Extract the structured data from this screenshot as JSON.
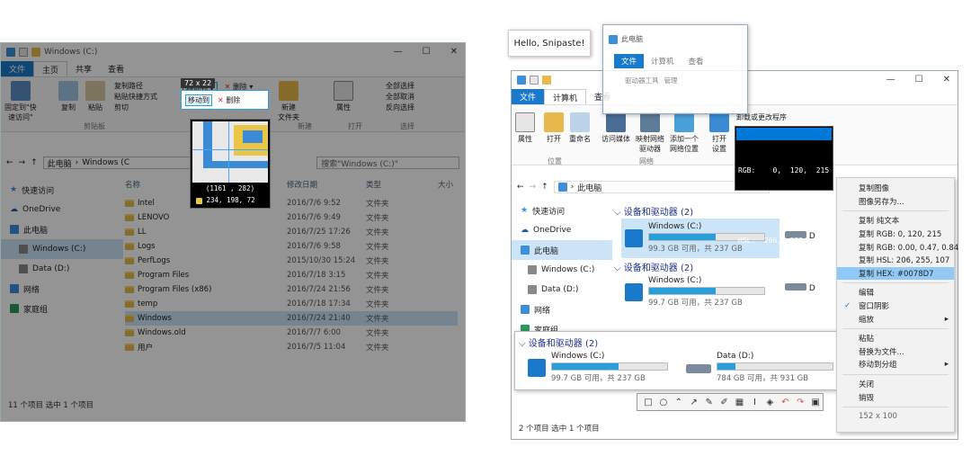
{
  "left": {
    "title": "Windows (C:)",
    "tabs": [
      "文件",
      "主页",
      "共享",
      "查看"
    ],
    "ribbon": {
      "pin": "固定到\"快\n速访问\"",
      "copy": "复制",
      "paste": "粘贴",
      "copy_path": "复制路径",
      "paste_shortcut": "粘贴快捷方式",
      "cut": "剪切",
      "move_to": "移动到",
      "delete": "删除",
      "new_folder": "新建\n文件夹",
      "properties": "属性",
      "select_all": "全部选择",
      "select_none": "全部取消",
      "invert": "反向选择",
      "group_clipboard": "剪贴板",
      "group_new": "新建",
      "group_open": "打开",
      "group_select": "选择"
    },
    "address": [
      "此电脑",
      "Windows (C"
    ],
    "search_placeholder": "搜索\"Windows (C:)\"",
    "nav": [
      "快速访问",
      "OneDrive",
      "此电脑",
      "Windows (C:)",
      "Data (D:)",
      "网络",
      "家庭组"
    ],
    "headers": [
      "名称",
      "修改日期",
      "类型",
      "大小"
    ],
    "files": [
      {
        "name": "Intel",
        "date": "2016/7/6 9:52",
        "type": "文件夹"
      },
      {
        "name": "LENOVO",
        "date": "2016/7/6 9:49",
        "type": "文件夹"
      },
      {
        "name": "LL",
        "date": "2016/7/25 17:26",
        "type": "文件夹"
      },
      {
        "name": "Logs",
        "date": "2016/7/6 9:58",
        "type": "文件夹"
      },
      {
        "name": "PerfLogs",
        "date": "2015/10/30 15:24",
        "type": "文件夹"
      },
      {
        "name": "Program Files",
        "date": "2016/7/18 3:15",
        "type": "文件夹"
      },
      {
        "name": "Program Files (x86)",
        "date": "2016/7/24 21:56",
        "type": "文件夹"
      },
      {
        "name": "temp",
        "date": "2016/7/18 17:34",
        "type": "文件夹"
      },
      {
        "name": "Windows",
        "date": "2016/7/24 21:40",
        "type": "文件夹"
      },
      {
        "name": "Windows.old",
        "date": "2016/7/7 6:00",
        "type": "文件夹"
      },
      {
        "name": "用户",
        "date": "2016/7/5 11:04",
        "type": "文件夹"
      }
    ],
    "status": "11 个项目    选中 1 个项目",
    "size_label": "72 x 22",
    "magnifier": {
      "coords": "(1161 , 282)",
      "rgb": "234, 198,  72"
    }
  },
  "right": {
    "sticky_text": "Hello, Snipaste!",
    "title": "此电脑",
    "tabs": [
      "文件",
      "计算机",
      "查看"
    ],
    "pinned_tabs": [
      "文件",
      "计算机",
      "查看"
    ],
    "pinned_ribbon": [
      "驱动器工具",
      "管理"
    ],
    "ribbon": [
      "属性",
      "打开",
      "重命名",
      "访问媒体",
      "映射网络\n驱动器",
      "添加一个\n网络位置",
      "打开\n设置",
      "卸载或更改程序"
    ],
    "groups": [
      "位置",
      "网络"
    ],
    "address": "此电脑",
    "nav": [
      "快速访问",
      "OneDrive",
      "此电脑",
      "Windows (C:)",
      "Data (D:)",
      "网络",
      "家庭组"
    ],
    "section": "设备和驱动器 (2)",
    "drives": [
      {
        "name": "Windows (C:)",
        "cap": "99.3 GB 可用，共 237 GB",
        "fill": 0.58
      },
      {
        "name": "Windows (C:)",
        "cap": "99.7 GB 可用，共 237 GB",
        "fill": 0.58
      },
      {
        "name": "Windows (C:)",
        "cap": "99.7 GB 可用，共 237 GB",
        "fill": 0.58
      },
      {
        "name": "Data (D:)",
        "cap": "784 GB 可用，共 931 GB",
        "fill": 0.16
      }
    ],
    "partial_drive": "D",
    "color": {
      "rgb": "RGB:    0,  120,  215",
      "rgbf": "RGB: 0.00, 0.47, 0.84",
      "hsl": "HSL:  206,  255,  107",
      "hex": "HEX:     #0078D7",
      "swatch": "#0078D7"
    },
    "menu": {
      "items": [
        "复制图像",
        "图像另存为...",
        "复制 纯文本",
        "复制 RGB: 0, 120, 215",
        "复制 RGB: 0.00, 0.47, 0.84",
        "复制 HSL: 206, 255, 107",
        "复制 HEX: #0078D7",
        "编辑",
        "窗口阴影",
        "缩放",
        "粘贴",
        "替换为文件...",
        "移动到分组",
        "关闭",
        "销毁",
        "152 x 100"
      ]
    },
    "status": "2 个项目    选中 1 个项目"
  }
}
